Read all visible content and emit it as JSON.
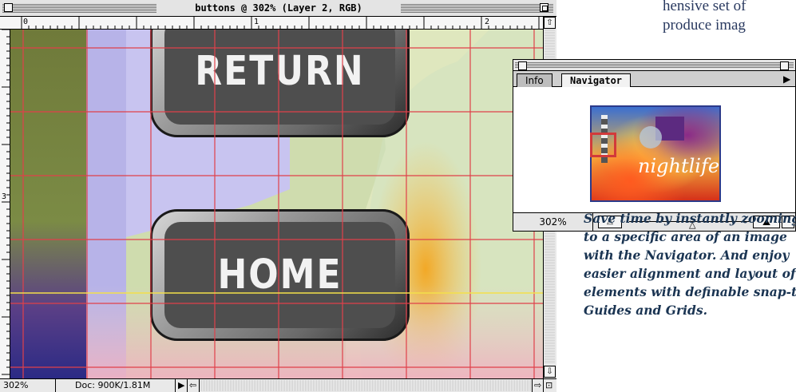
{
  "document_window": {
    "title": "buttons @ 302% (Layer 2, RGB)",
    "ruler_top": [
      "0",
      "1",
      "2"
    ],
    "ruler_left": [
      "3"
    ],
    "zoom": "302%",
    "doc_info": "Doc: 900K/1.81M"
  },
  "image_buttons": [
    {
      "label": "RETURN"
    },
    {
      "label": "HOME"
    }
  ],
  "navigator_palette": {
    "tabs": [
      "Info",
      "Navigator"
    ],
    "active_tab": "Navigator",
    "thumbnail_text": "nightlife",
    "zoom": "302%"
  },
  "caption": {
    "lines": [
      "Save time by instantly zooming",
      "to a specific area of an image",
      "with the Navigator. And enjoy",
      "easier alignment and layout of",
      "elements with definable snap-to",
      "Guides and Grids."
    ]
  },
  "page_text": {
    "lines": [
      "hensive set of",
      "produce imag"
    ]
  },
  "colors": {
    "guide_red": "#e0404a",
    "guide_yellow": "#f4e04a",
    "caption_blue": "#1a3452"
  }
}
